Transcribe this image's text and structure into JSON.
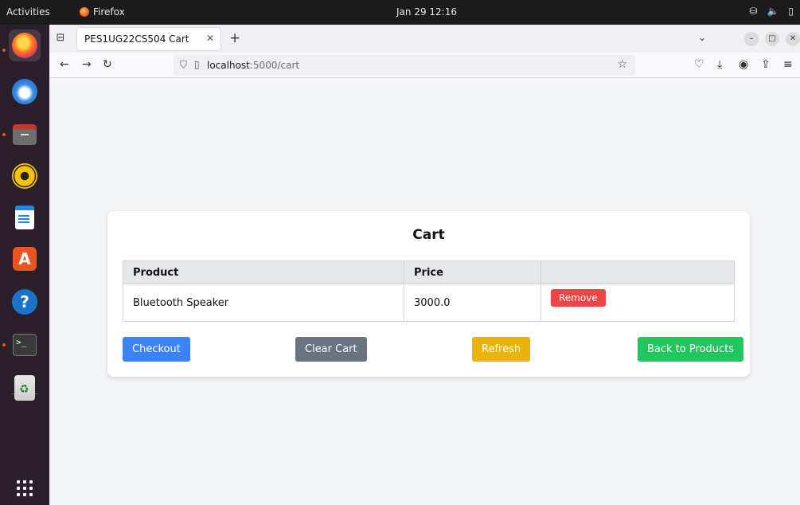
{
  "system": {
    "activities": "Activities",
    "app_name": "Firefox",
    "clock": "Jan 29  12:16"
  },
  "browser": {
    "tab_title": "PES1UG22CS504 Cart",
    "url_host": "localhost",
    "url_path": ":5000/cart"
  },
  "page": {
    "title": "Cart",
    "table": {
      "headers": [
        "Product",
        "Price",
        ""
      ],
      "rows": [
        {
          "product": "Bluetooth Speaker",
          "price": "3000.0",
          "action": "Remove"
        }
      ]
    },
    "buttons": {
      "checkout": "Checkout",
      "clear": "Clear Cart",
      "refresh": "Refresh",
      "back": "Back to Products"
    }
  },
  "colors": {
    "checkout": "#3b82f6",
    "clear": "#6b7280",
    "refresh": "#eab308",
    "back": "#22c55e",
    "remove": "#ef4444"
  },
  "icons": {
    "dock": [
      "firefox-icon",
      "thunderbird-icon",
      "files-icon",
      "rhythmbox-icon",
      "writer-icon",
      "app-center-icon",
      "help-icon",
      "terminal-icon",
      "trash-icon",
      "show-apps-icon"
    ]
  }
}
